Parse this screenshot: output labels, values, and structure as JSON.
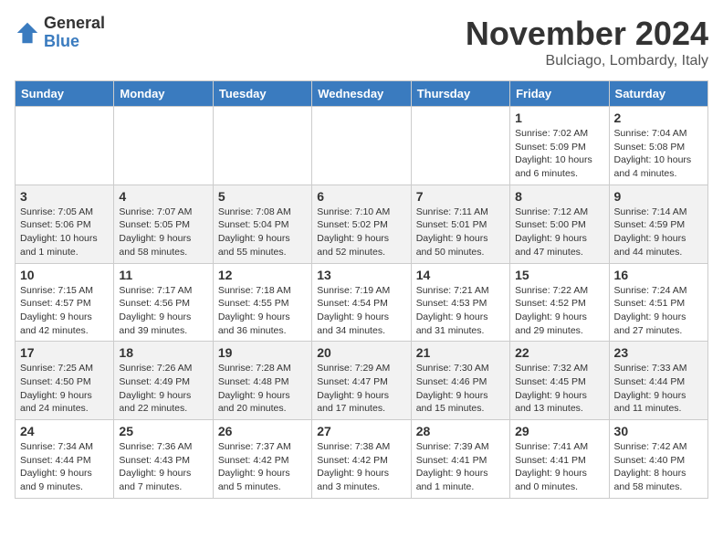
{
  "logo": {
    "general": "General",
    "blue": "Blue"
  },
  "title": "November 2024",
  "location": "Bulciago, Lombardy, Italy",
  "days_of_week": [
    "Sunday",
    "Monday",
    "Tuesday",
    "Wednesday",
    "Thursday",
    "Friday",
    "Saturday"
  ],
  "weeks": [
    [
      {
        "day": "",
        "info": ""
      },
      {
        "day": "",
        "info": ""
      },
      {
        "day": "",
        "info": ""
      },
      {
        "day": "",
        "info": ""
      },
      {
        "day": "",
        "info": ""
      },
      {
        "day": "1",
        "info": "Sunrise: 7:02 AM\nSunset: 5:09 PM\nDaylight: 10 hours and 6 minutes."
      },
      {
        "day": "2",
        "info": "Sunrise: 7:04 AM\nSunset: 5:08 PM\nDaylight: 10 hours and 4 minutes."
      }
    ],
    [
      {
        "day": "3",
        "info": "Sunrise: 7:05 AM\nSunset: 5:06 PM\nDaylight: 10 hours and 1 minute."
      },
      {
        "day": "4",
        "info": "Sunrise: 7:07 AM\nSunset: 5:05 PM\nDaylight: 9 hours and 58 minutes."
      },
      {
        "day": "5",
        "info": "Sunrise: 7:08 AM\nSunset: 5:04 PM\nDaylight: 9 hours and 55 minutes."
      },
      {
        "day": "6",
        "info": "Sunrise: 7:10 AM\nSunset: 5:02 PM\nDaylight: 9 hours and 52 minutes."
      },
      {
        "day": "7",
        "info": "Sunrise: 7:11 AM\nSunset: 5:01 PM\nDaylight: 9 hours and 50 minutes."
      },
      {
        "day": "8",
        "info": "Sunrise: 7:12 AM\nSunset: 5:00 PM\nDaylight: 9 hours and 47 minutes."
      },
      {
        "day": "9",
        "info": "Sunrise: 7:14 AM\nSunset: 4:59 PM\nDaylight: 9 hours and 44 minutes."
      }
    ],
    [
      {
        "day": "10",
        "info": "Sunrise: 7:15 AM\nSunset: 4:57 PM\nDaylight: 9 hours and 42 minutes."
      },
      {
        "day": "11",
        "info": "Sunrise: 7:17 AM\nSunset: 4:56 PM\nDaylight: 9 hours and 39 minutes."
      },
      {
        "day": "12",
        "info": "Sunrise: 7:18 AM\nSunset: 4:55 PM\nDaylight: 9 hours and 36 minutes."
      },
      {
        "day": "13",
        "info": "Sunrise: 7:19 AM\nSunset: 4:54 PM\nDaylight: 9 hours and 34 minutes."
      },
      {
        "day": "14",
        "info": "Sunrise: 7:21 AM\nSunset: 4:53 PM\nDaylight: 9 hours and 31 minutes."
      },
      {
        "day": "15",
        "info": "Sunrise: 7:22 AM\nSunset: 4:52 PM\nDaylight: 9 hours and 29 minutes."
      },
      {
        "day": "16",
        "info": "Sunrise: 7:24 AM\nSunset: 4:51 PM\nDaylight: 9 hours and 27 minutes."
      }
    ],
    [
      {
        "day": "17",
        "info": "Sunrise: 7:25 AM\nSunset: 4:50 PM\nDaylight: 9 hours and 24 minutes."
      },
      {
        "day": "18",
        "info": "Sunrise: 7:26 AM\nSunset: 4:49 PM\nDaylight: 9 hours and 22 minutes."
      },
      {
        "day": "19",
        "info": "Sunrise: 7:28 AM\nSunset: 4:48 PM\nDaylight: 9 hours and 20 minutes."
      },
      {
        "day": "20",
        "info": "Sunrise: 7:29 AM\nSunset: 4:47 PM\nDaylight: 9 hours and 17 minutes."
      },
      {
        "day": "21",
        "info": "Sunrise: 7:30 AM\nSunset: 4:46 PM\nDaylight: 9 hours and 15 minutes."
      },
      {
        "day": "22",
        "info": "Sunrise: 7:32 AM\nSunset: 4:45 PM\nDaylight: 9 hours and 13 minutes."
      },
      {
        "day": "23",
        "info": "Sunrise: 7:33 AM\nSunset: 4:44 PM\nDaylight: 9 hours and 11 minutes."
      }
    ],
    [
      {
        "day": "24",
        "info": "Sunrise: 7:34 AM\nSunset: 4:44 PM\nDaylight: 9 hours and 9 minutes."
      },
      {
        "day": "25",
        "info": "Sunrise: 7:36 AM\nSunset: 4:43 PM\nDaylight: 9 hours and 7 minutes."
      },
      {
        "day": "26",
        "info": "Sunrise: 7:37 AM\nSunset: 4:42 PM\nDaylight: 9 hours and 5 minutes."
      },
      {
        "day": "27",
        "info": "Sunrise: 7:38 AM\nSunset: 4:42 PM\nDaylight: 9 hours and 3 minutes."
      },
      {
        "day": "28",
        "info": "Sunrise: 7:39 AM\nSunset: 4:41 PM\nDaylight: 9 hours and 1 minute."
      },
      {
        "day": "29",
        "info": "Sunrise: 7:41 AM\nSunset: 4:41 PM\nDaylight: 9 hours and 0 minutes."
      },
      {
        "day": "30",
        "info": "Sunrise: 7:42 AM\nSunset: 4:40 PM\nDaylight: 8 hours and 58 minutes."
      }
    ]
  ]
}
